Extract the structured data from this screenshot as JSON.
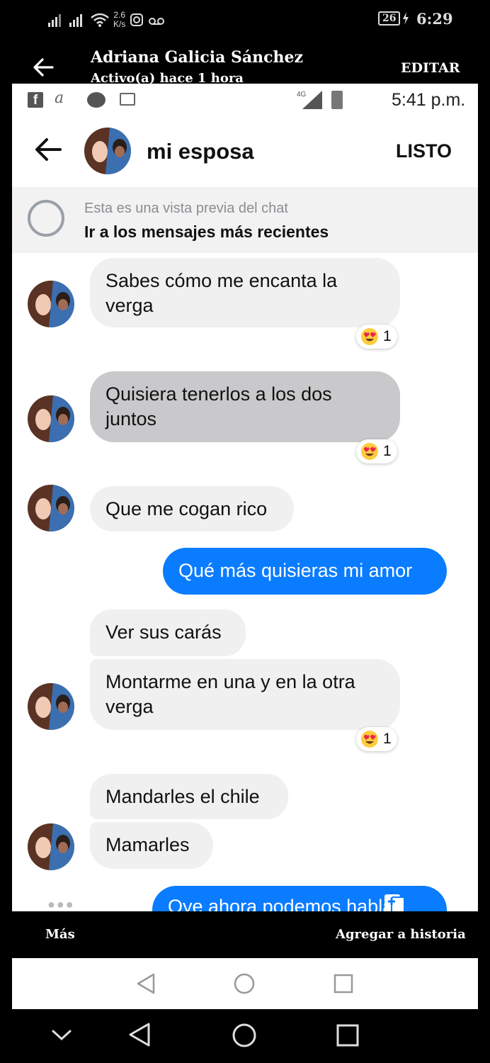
{
  "status_bar": {
    "network_speed_value": "2.6",
    "network_speed_unit": "K/s",
    "battery": "26",
    "time": "6:29"
  },
  "story_header": {
    "name": "Adriana Galicia Sánchez",
    "active": "Activo(a) hace 1 hora",
    "edit_label": "EDITAR"
  },
  "inner_status": {
    "network": "4G",
    "time": "5:41 p.m."
  },
  "conversation": {
    "title": "mi esposa",
    "done_label": "LISTO",
    "preview_notice": "Esta es una vista previa del chat",
    "preview_link": "Ir a los mensajes más recientes"
  },
  "messages": [
    {
      "text_line1": "Sabes cómo me encanta la",
      "text_line2": "verga",
      "reaction_count": "1"
    },
    {
      "text_line1": "Quisiera tenerlos a los dos",
      "text_line2": "juntos",
      "reaction_count": "1"
    },
    {
      "text": "Que me cogan rico"
    },
    {
      "text": "Qué más quisieras mi amor"
    },
    {
      "text": "Ver sus carás"
    },
    {
      "text_line1": "Montarme en una y en la otra",
      "text_line2": "verga",
      "reaction_count": "1"
    },
    {
      "text": "Mandarles el chile"
    },
    {
      "text": "Mamarles"
    },
    {
      "text": "Oye ahora podemos hablar"
    }
  ],
  "story_footer": {
    "more_label": "Más",
    "add_story_label": "Agregar a historia"
  },
  "colors": {
    "outgoing_bubble": "#0a7cff",
    "incoming_bubble": "#f1f0f0",
    "selected_bubble": "#c9c9cb"
  },
  "icons": [
    "signal-icon",
    "wifi-icon",
    "instagram-icon",
    "voicemail-icon",
    "back-arrow-icon",
    "facebook-icon",
    "messenger-icon",
    "image-icon",
    "battery-icon",
    "heart-eyes-emoji-icon",
    "chat-bubble-icon",
    "gallery-icon",
    "back-nav-icon",
    "home-nav-icon",
    "recents-nav-icon",
    "chevron-down-icon"
  ]
}
